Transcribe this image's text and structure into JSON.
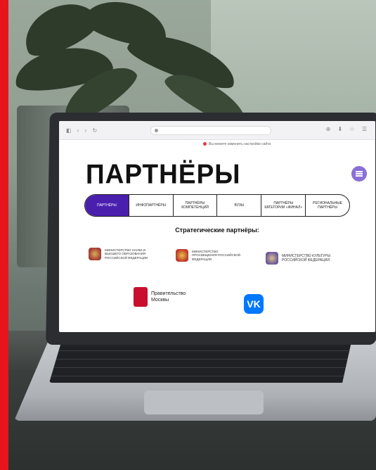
{
  "page": {
    "title": "ПАРТНЁРЫ",
    "notice": "Вы можете изменить настройки сайта"
  },
  "tabs": [
    {
      "label": "ПАРТНЁРЫ",
      "active": true
    },
    {
      "label": "ИНФОПАРТНЁРЫ",
      "active": false
    },
    {
      "label": "ПАРТНЁРЫ КОМПЕТЕНЦИЙ",
      "active": false
    },
    {
      "label": "ВУЗЫ",
      "active": false
    },
    {
      "label": "ПАРТНЁРЫ КАТЕГОРИИ «ФИНАЛ»",
      "active": false
    },
    {
      "label": "РЕГИОНАЛЬНЫЕ ПАРТНЁРЫ",
      "active": false
    }
  ],
  "section": {
    "title": "Стратегические партнёры:"
  },
  "partners": [
    {
      "name": "МИНИСТЕРСТВО НАУКИ И ВЫСШЕГО ОБРАЗОВАНИЯ РОССИЙСКОЙ ФЕДЕРАЦИИ",
      "icon": "eagle-emblem-icon"
    },
    {
      "name": "МИНИСТЕРСТВО ПРОСВЕЩЕНИЯ РОССИЙСКОЙ ФЕДЕРАЦИИ",
      "icon": "eagle-emblem-icon"
    },
    {
      "name": "МИНИСТЕРСТВО КУЛЬТУРЫ РОССИЙСКОЙ ФЕДЕРАЦИИ",
      "icon": "eagle-emblem-icon"
    },
    {
      "name": "Правительство Москвы",
      "icon": "moscow-coat-of-arms-icon"
    },
    {
      "name": "VK",
      "icon": "vk-logo-icon"
    }
  ],
  "colors": {
    "accent": "#4a1fae",
    "menu": "#8a6fd6",
    "red_bar": "#e8141c",
    "vk": "#0077ff"
  }
}
